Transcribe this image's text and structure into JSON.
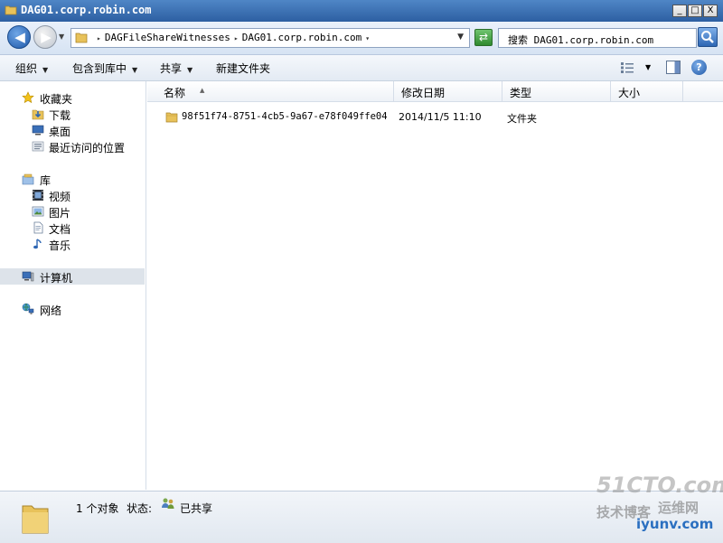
{
  "window": {
    "title": "DAG01.corp.robin.com",
    "minimize": "_",
    "maximize": "□",
    "close": "X"
  },
  "address": {
    "crumbs": [
      "DAGFileShareWitnesses",
      "DAG01.corp.robin.com"
    ],
    "search_placeholder": "搜索 DAG01.corp.robin.com"
  },
  "toolbar": {
    "organize": "组织",
    "include_in_library": "包含到库中",
    "share": "共享",
    "new_folder": "新建文件夹"
  },
  "nav": {
    "favorites": "收藏夹",
    "downloads": "下载",
    "desktop": "桌面",
    "recent": "最近访问的位置",
    "libraries": "库",
    "videos": "视频",
    "pictures": "图片",
    "documents": "文档",
    "music": "音乐",
    "computer": "计算机",
    "network": "网络"
  },
  "columns": {
    "name": "名称",
    "modified": "修改日期",
    "type": "类型",
    "size": "大小"
  },
  "files": [
    {
      "name": "98f51f74-8751-4cb5-9a67-e78f049ffe04",
      "modified": "2014/11/5 11:10",
      "type": "文件夹",
      "size": ""
    }
  ],
  "status": {
    "count": "1 个对象",
    "state_label": "状态:",
    "state_value": "已共享"
  },
  "watermark": {
    "main": "51CTO.com",
    "sub": "技术博客",
    "cn": "运维网",
    "url": "iyunv.com"
  },
  "colors": {
    "titlebar": "#2d5fa2",
    "selected_nav": "#dde3ea",
    "accent_blue": "#1c57a8",
    "folder_yellow": "#e8c25a"
  }
}
